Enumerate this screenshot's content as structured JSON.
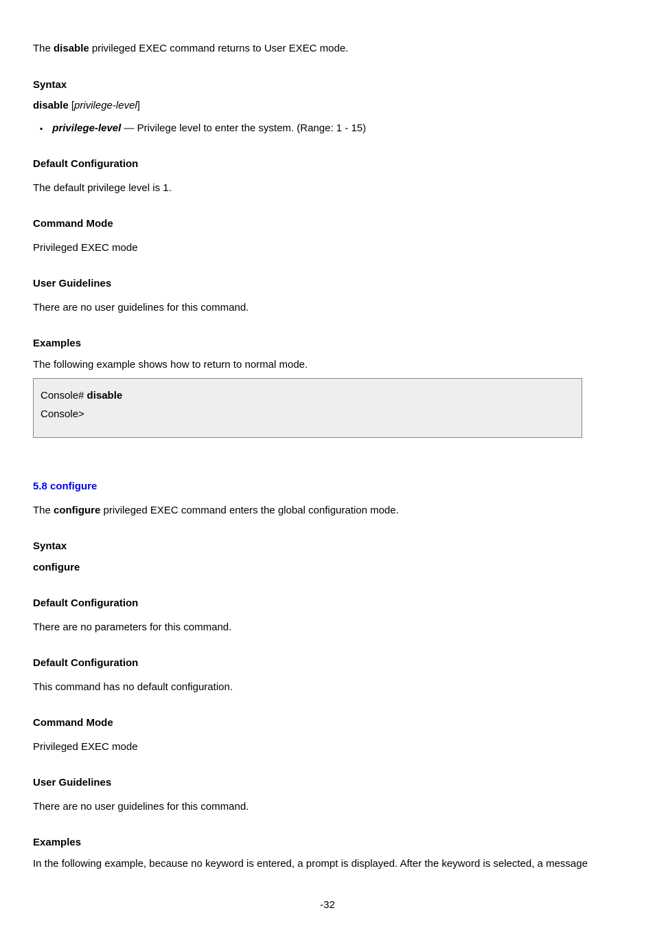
{
  "section1": {
    "desc_pre": "The ",
    "desc_bold": "disable",
    "desc_post": " privileged EXEC command returns to User EXEC mode.",
    "syntax_heading": "Syntax",
    "syntax_bold": "disable ",
    "syntax_lb": "[",
    "syntax_italic": "privilege-level",
    "syntax_rb": "]",
    "bullet_param": "privilege-level ",
    "bullet_desc": "— Privilege level to enter the system. (Range: 1 - 15)",
    "default_heading": "Default Configuration",
    "default_text": "The default privilege level is 1.",
    "mode_heading": "Command Mode",
    "mode_text": "Privileged EXEC mode",
    "guidelines_heading": "User Guidelines",
    "guidelines_text": "There are no user guidelines for this command.",
    "example_heading": "Examples",
    "example_text": "The following example shows how to return to normal mode.",
    "code_line1_prompt": "Console# ",
    "code_line1_cmd": "disable",
    "code_line2": "Console>"
  },
  "section2": {
    "anchor": "5.8 configure",
    "desc_pre": "The ",
    "desc_bold": "configure",
    "desc_post": " privileged EXEC command enters the global configuration mode.",
    "syntax_heading": "Syntax",
    "syntax_bold": "configure",
    "default_heading": "Default Configuration",
    "default_text": "There are no parameters for this command.",
    "default_heading2": "Default Configuration",
    "default_text2": "This command has no default configuration.",
    "mode_heading": "Command Mode",
    "mode_text": "Privileged EXEC mode",
    "guidelines_heading": "User Guidelines",
    "guidelines_text": "There are no user guidelines for this command.",
    "example_heading": "Examples",
    "example_text": "In the following example, because no keyword is entered, a prompt is displayed. After the keyword is selected, a message"
  },
  "footer": {
    "page_number": "-32"
  }
}
